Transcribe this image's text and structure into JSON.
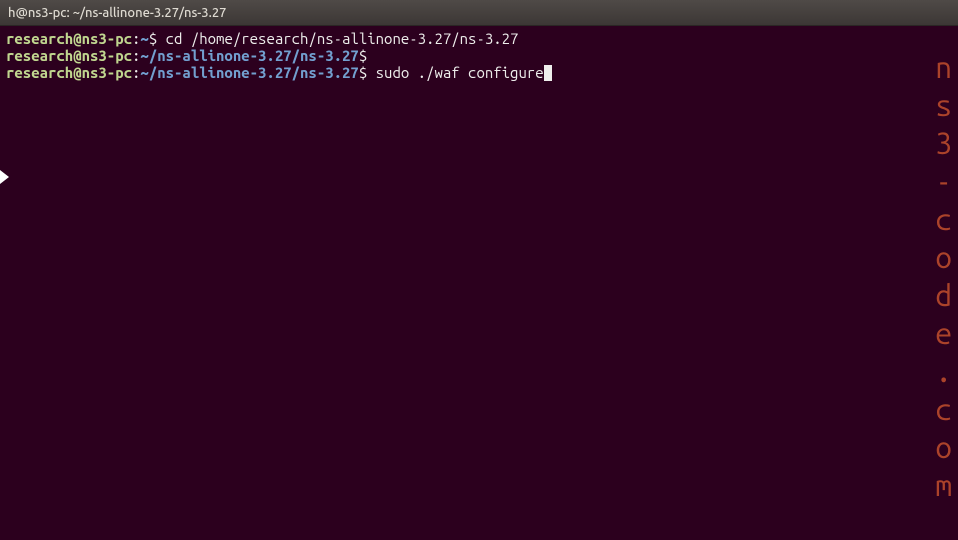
{
  "titlebar": {
    "text": "h@ns3-pc: ~/ns-allinone-3.27/ns-3.27"
  },
  "lines": [
    {
      "user": "research@ns3-pc",
      "sep": ":",
      "path": "~",
      "dollar": "$ ",
      "command": "cd /home/research/ns-allinone-3.27/ns-3.27"
    },
    {
      "user": "research@ns3-pc",
      "sep": ":",
      "path": "~/ns-allinone-3.27/ns-3.27",
      "dollar": "$",
      "command": ""
    },
    {
      "user": "research@ns3-pc",
      "sep": ":",
      "path": "~/ns-allinone-3.27/ns-3.27",
      "dollar": "$ ",
      "command": "sudo ./waf configure"
    }
  ],
  "watermark": {
    "c0": "n",
    "c1": "s",
    "c2": "3",
    "c3": "-",
    "c4": "c",
    "c5": "o",
    "c6": "d",
    "c7": "e",
    "c8": ".",
    "c9": "c",
    "c10": "o",
    "c11": "m"
  }
}
